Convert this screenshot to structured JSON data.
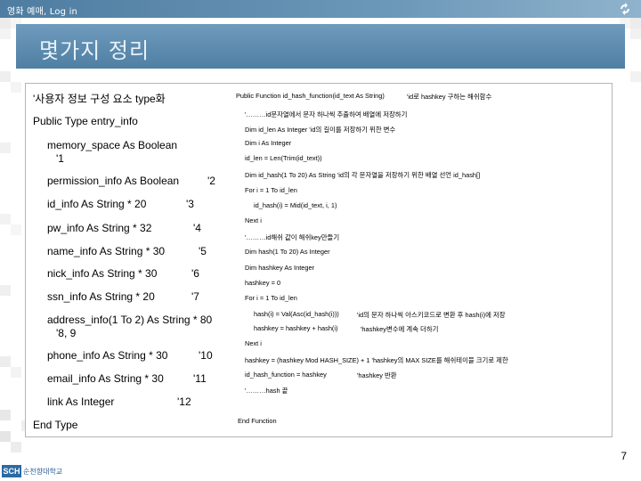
{
  "header": {
    "title": "영화 예매, Log in",
    "icon": "recycle-arrows-icon"
  },
  "banner": {
    "title": "몇가지 정리"
  },
  "left_code": [
    "'사용자 정보 구성 요소 type화",
    "Public Type entry_info",
    "memory_space As Boolean",
    "'1",
    "permission_info As Boolean",
    "'2",
    "id_info As String * 20",
    "'3",
    "pw_info As String * 32",
    "'4",
    "name_info As String * 30",
    "'5",
    "nick_info As String * 30",
    "'6",
    "ssn_info As String * 20",
    "'7",
    "address_info(1 To 2) As String * 80",
    "'8, 9",
    "phone_info As String * 30",
    "'10",
    "email_info As String * 30",
    "'11",
    "link As Integer",
    "'12",
    "End Type"
  ],
  "right_code": [
    "Public Function id_hash_function(id_text As String)",
    "'id로 hashkey 구하는 해쉬함수",
    "'………id문자열에서 문자 하나씩 추출하여 배열에 저장하기",
    "Dim id_len As Integer 'id의 길이를 저장하기 위한 변수",
    "Dim i As Integer",
    "id_len = Len(Trim(id_text))",
    "Dim id_hash(1 To 20) As String 'id의 각 문자열을 저장하기 위한 배열 선언 id_hash[]",
    "For i = 1 To id_len",
    "id_hash(i) = Mid(id_text, i, 1)",
    "Next i",
    "'………id해쉬 값이 해쉬key만들기",
    "Dim hash(1 To 20) As Integer",
    "Dim hashkey As Integer",
    "hashkey = 0",
    "For i = 1 To id_len",
    "hash(i) = Val(Asc(id_hash(i)))",
    "'id의 문자 하나씩 아스키코드로 변환 후 hash(i)에 저장",
    "hashkey = hashkey + hash(i)",
    "'hashkey변수에 계속 더하기",
    "Next i",
    "hashkey = (hashkey Mod HASH_SIZE) + 1 'hashkey의 MAX SIZE를 해쉬테이블 크기로 제한",
    "id_hash_function = hashkey",
    "'hashkey 반환",
    "'………hash 끝",
    "End Function"
  ],
  "footer": {
    "page_number": "7",
    "logo_badge": "SCH",
    "logo_text": "순천향대학교"
  },
  "colors": {
    "topbar": "#5f8db0",
    "banner": "#5a89ad",
    "banner_text": "#e8f2fa",
    "logo": "#2a6aa6"
  }
}
